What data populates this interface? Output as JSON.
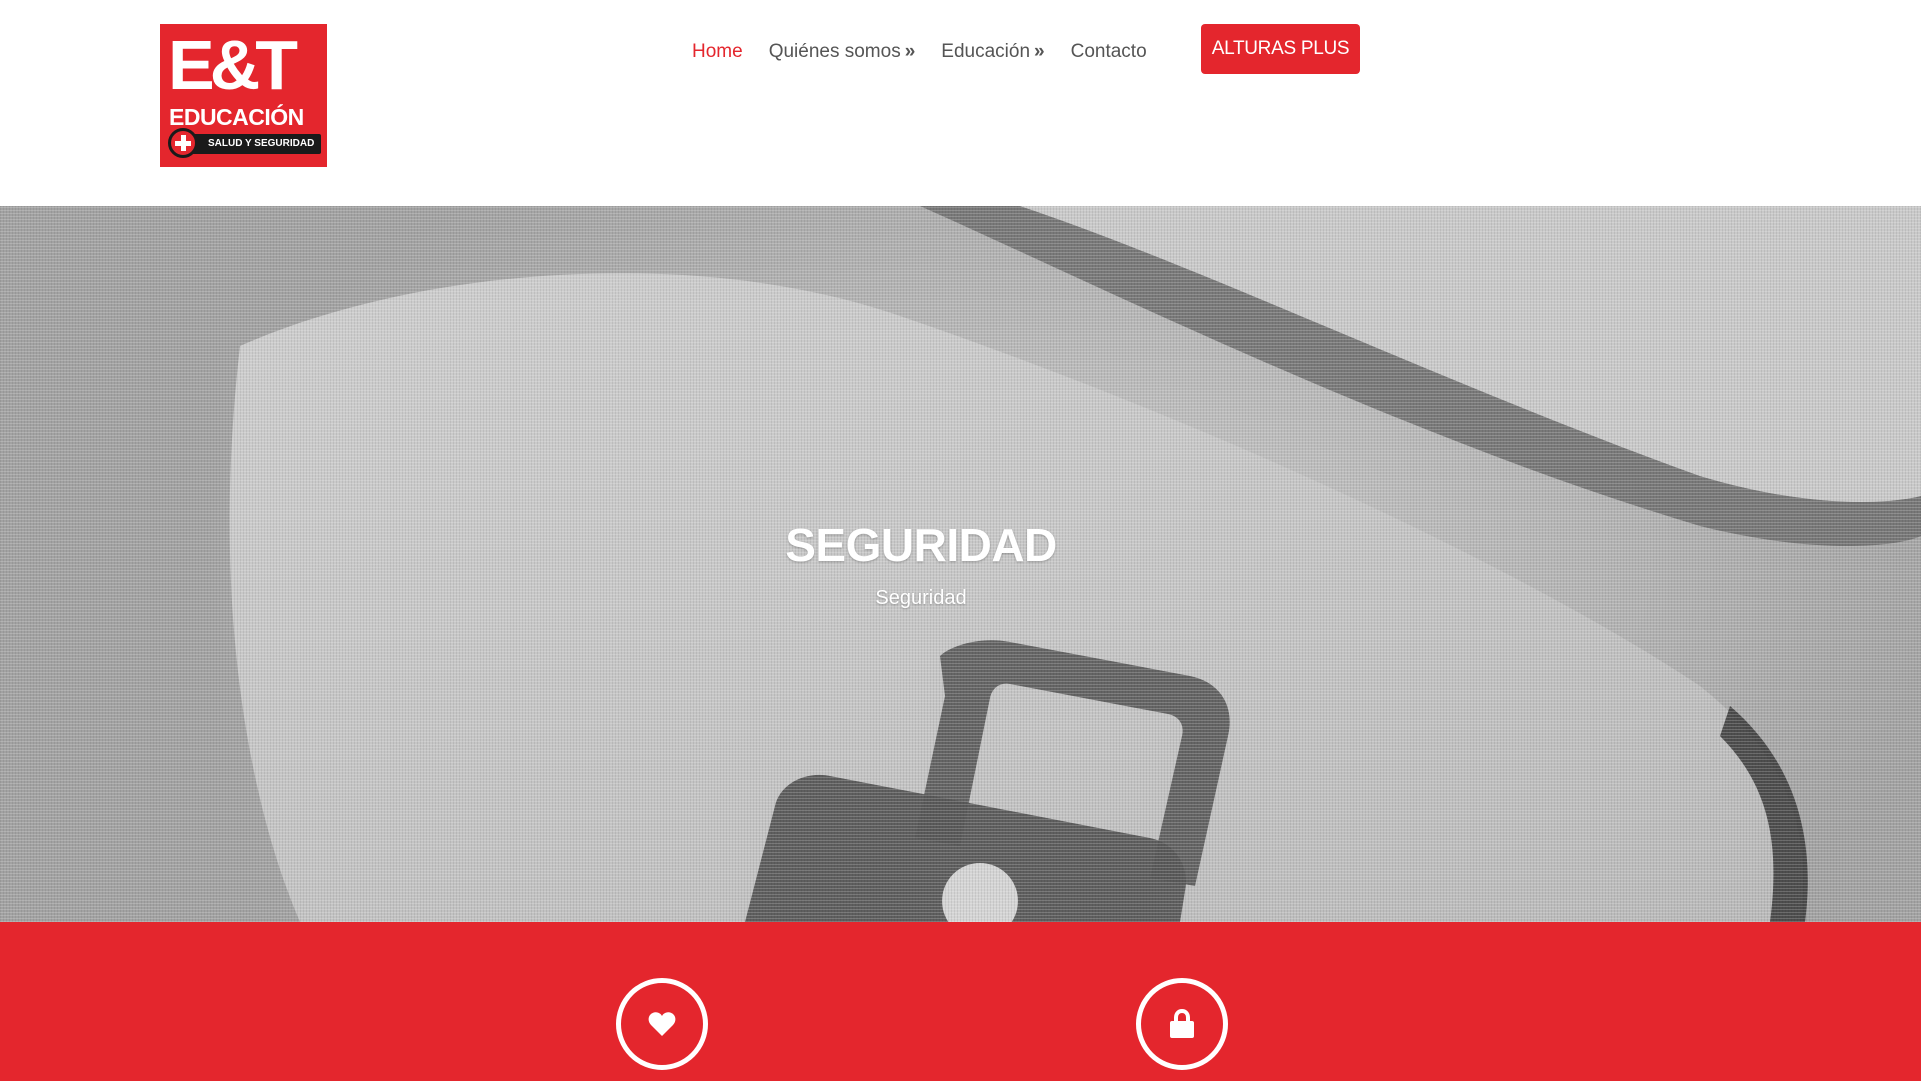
{
  "logo": {
    "main": "E&T",
    "sub": "EDUCACIÓN",
    "tagline": "SALUD Y SEGURIDAD",
    "icon": "medical-cross-icon"
  },
  "nav": {
    "items": [
      {
        "label": "Home",
        "active": true,
        "has_submenu": false
      },
      {
        "label": "Quiénes somos",
        "active": false,
        "has_submenu": true
      },
      {
        "label": "Educación",
        "active": false,
        "has_submenu": true
      },
      {
        "label": "Contacto",
        "active": false,
        "has_submenu": false
      }
    ],
    "submenu_arrow": "»",
    "cta_label": "ALTURAS PLUS"
  },
  "hero": {
    "title": "SEGURIDAD",
    "subtitle": "Seguridad",
    "background_image": "padlock-key-image"
  },
  "features": {
    "icons": [
      {
        "name": "heart-icon"
      },
      {
        "name": "lock-icon"
      }
    ]
  },
  "colors": {
    "brand_red": "#e4262d",
    "nav_text": "#555555",
    "white": "#ffffff"
  }
}
